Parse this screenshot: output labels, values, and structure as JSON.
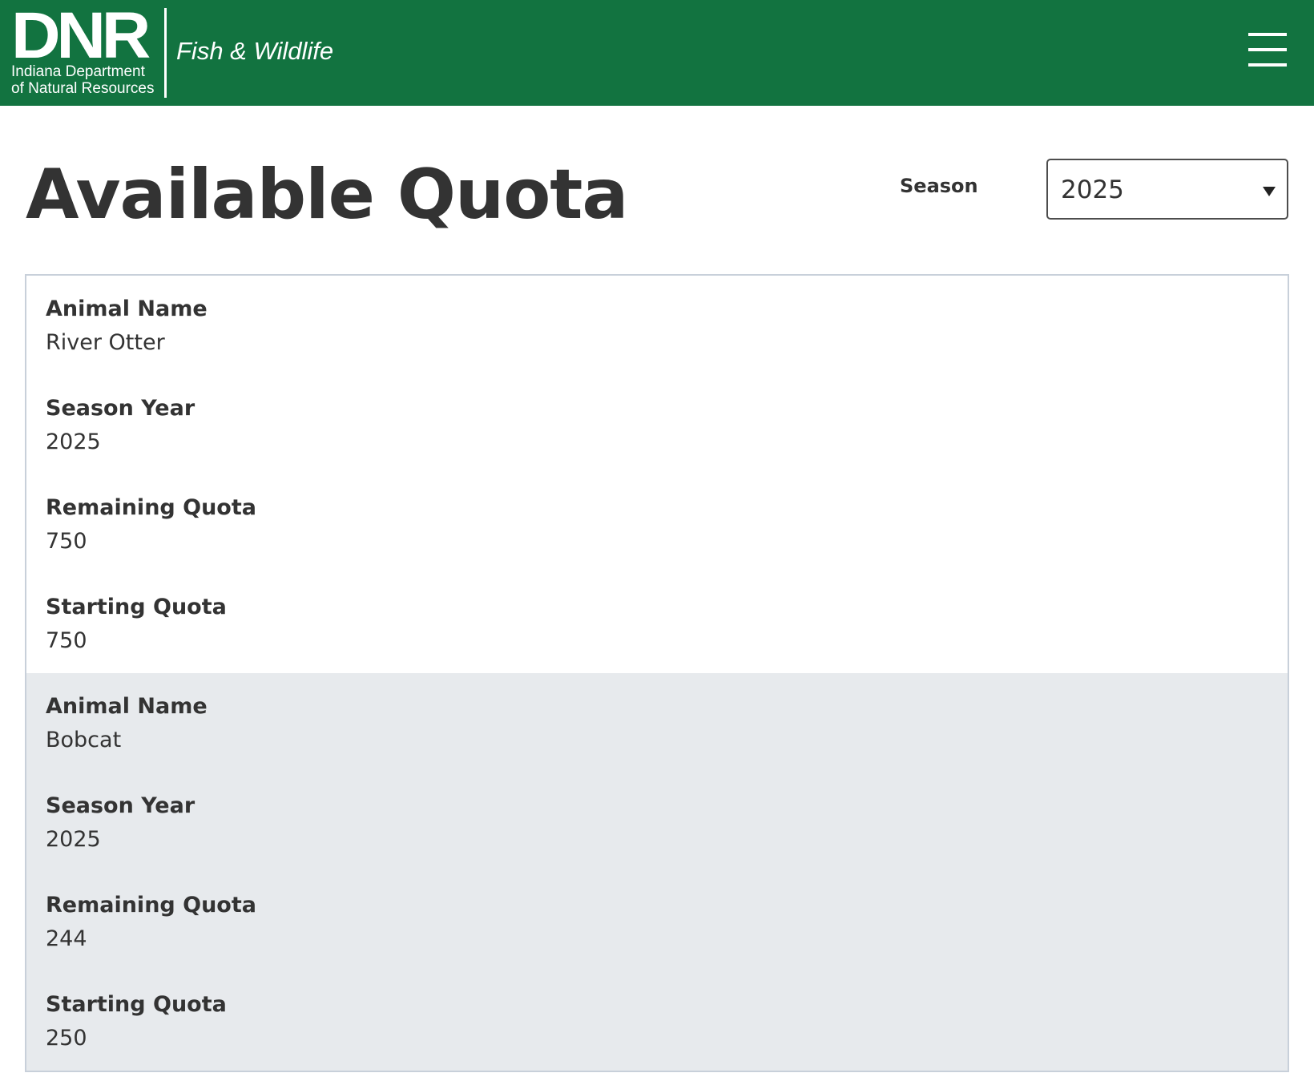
{
  "header": {
    "logo_text": "DNR",
    "agency_line1": "Indiana Department",
    "agency_line2": "of Natural Resources",
    "program_name": "Fish & Wildlife",
    "menu_icon": "hamburger-menu-icon"
  },
  "page": {
    "title": "Available Quota"
  },
  "season_filter": {
    "label": "Season",
    "selected": "2025",
    "caret_icon": "caret-down-icon"
  },
  "quotas": [
    {
      "fields": [
        {
          "label": "Animal Name",
          "value": "River Otter"
        },
        {
          "label": "Season Year",
          "value": "2025"
        },
        {
          "label": "Remaining Quota",
          "value": "750"
        },
        {
          "label": "Starting Quota",
          "value": "750"
        }
      ]
    },
    {
      "fields": [
        {
          "label": "Animal Name",
          "value": "Bobcat"
        },
        {
          "label": "Season Year",
          "value": "2025"
        },
        {
          "label": "Remaining Quota",
          "value": "244"
        },
        {
          "label": "Starting Quota",
          "value": "250"
        }
      ]
    }
  ],
  "colors": {
    "header_bg": "#127340",
    "alt_row_bg": "#e7eaed",
    "text": "#333333"
  }
}
